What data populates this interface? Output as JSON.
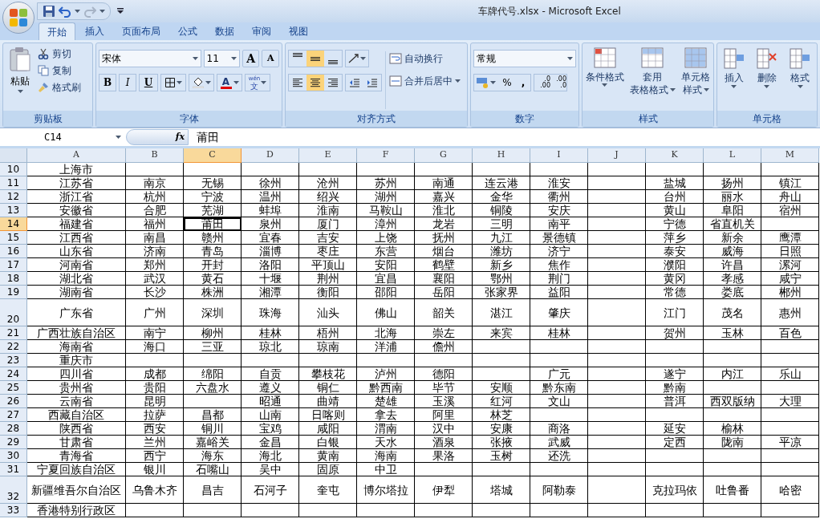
{
  "window": {
    "title": "车牌代号.xlsx - Microsoft Excel"
  },
  "tabs": [
    {
      "label": "开始",
      "selected": true
    },
    {
      "label": "插入",
      "selected": false
    },
    {
      "label": "页面布局",
      "selected": false
    },
    {
      "label": "公式",
      "selected": false
    },
    {
      "label": "数据",
      "selected": false
    },
    {
      "label": "审阅",
      "selected": false
    },
    {
      "label": "视图",
      "selected": false
    }
  ],
  "clipboard": {
    "title": "剪贴板",
    "paste": "粘贴",
    "cut": "剪切",
    "copy": "复制",
    "format_painter": "格式刷"
  },
  "font": {
    "title": "字体",
    "name": "宋体",
    "size": "11",
    "bold": "B",
    "italic": "I",
    "underline": "U",
    "grow": "A",
    "shrink": "A",
    "color_letter": "A",
    "phonetic_top": "wén",
    "phonetic_bottom": "文"
  },
  "alignment": {
    "title": "对齐方式",
    "vertical": [
      {
        "selected": false
      },
      {
        "selected": true
      },
      {
        "selected": false
      }
    ],
    "horizontal": [
      {
        "selected": false
      },
      {
        "selected": true
      },
      {
        "selected": false
      }
    ],
    "wrap": "自动换行",
    "merge": "合并后居中"
  },
  "number": {
    "title": "数字",
    "format": "常规",
    "percent": "%",
    "comma": ",",
    "inc_decimal_top": ".0",
    "inc_decimal_bottom": ".00",
    "dec_decimal_top": ".00",
    "dec_decimal_bottom": ".0"
  },
  "styles": {
    "title": "样式",
    "buttons": [
      {
        "line1": "条件格式"
      },
      {
        "line1": "套用",
        "line2": "表格格式"
      },
      {
        "line1": "单元格",
        "line2": "样式"
      }
    ]
  },
  "cells_group": {
    "title": "单元格",
    "buttons": [
      "插入",
      "删除",
      "格式"
    ]
  },
  "formula_bar": {
    "name_box": "C14",
    "fx": "fx",
    "value": "莆田"
  },
  "grid": {
    "columns": [
      {
        "label": "A",
        "selected": false
      },
      {
        "label": "B",
        "selected": false
      },
      {
        "label": "C",
        "selected": true
      },
      {
        "label": "D",
        "selected": false
      },
      {
        "label": "E",
        "selected": false
      },
      {
        "label": "F",
        "selected": false
      },
      {
        "label": "G",
        "selected": false
      },
      {
        "label": "H",
        "selected": false
      },
      {
        "label": "I",
        "selected": false
      },
      {
        "label": "J",
        "selected": false
      },
      {
        "label": "K",
        "selected": false
      },
      {
        "label": "L",
        "selected": false
      },
      {
        "label": "M",
        "selected": false
      }
    ],
    "rows": [
      {
        "number": "10",
        "kind": "normal",
        "selected": false,
        "cells": [
          "上海市",
          null,
          null,
          null,
          null,
          null,
          null,
          null,
          null,
          null,
          null,
          null,
          null
        ]
      },
      {
        "number": "11",
        "kind": "normal",
        "selected": false,
        "cells": [
          "江苏省",
          "南京",
          "无锡",
          "徐州",
          "沧州",
          "苏州",
          "南通",
          "连云港",
          "淮安",
          null,
          "盐城",
          "扬州",
          "镇江"
        ]
      },
      {
        "number": "12",
        "kind": "normal",
        "selected": false,
        "cells": [
          "浙江省",
          "杭州",
          "宁波",
          "温州",
          "绍兴",
          "湖州",
          "嘉兴",
          "金华",
          "衢州",
          null,
          "台州",
          "丽水",
          "舟山"
        ]
      },
      {
        "number": "13",
        "kind": "normal",
        "selected": false,
        "cells": [
          "安徽省",
          "合肥",
          "芜湖",
          "蚌埠",
          "淮南",
          "马鞍山",
          "淮北",
          "铜陵",
          "安庆",
          null,
          "黄山",
          "阜阳",
          "宿州"
        ]
      },
      {
        "number": "14",
        "kind": "normal",
        "selected": true,
        "cells": [
          "福建省",
          "福州",
          "莆田",
          "泉州",
          "厦门",
          "漳州",
          "龙岩",
          "三明",
          "南平",
          null,
          "宁德",
          "省直机关",
          null
        ]
      },
      {
        "number": "15",
        "kind": "normal",
        "selected": false,
        "cells": [
          "江西省",
          "南昌",
          "赣州",
          "宜春",
          "吉安",
          "上饶",
          "抚州",
          "九江",
          "景德镇",
          null,
          "萍乡",
          "新余",
          "鹰潭"
        ]
      },
      {
        "number": "16",
        "kind": "normal",
        "selected": false,
        "cells": [
          "山东省",
          "济南",
          "青岛",
          "淄博",
          "枣庄",
          "东营",
          "烟台",
          "潍坊",
          "济宁",
          null,
          "泰安",
          "威海",
          "日照"
        ]
      },
      {
        "number": "17",
        "kind": "normal",
        "selected": false,
        "cells": [
          "河南省",
          "郑州",
          "开封",
          "洛阳",
          "平顶山",
          "安阳",
          "鹤壁",
          "新乡",
          "焦作",
          null,
          "濮阳",
          "许昌",
          "漯河"
        ]
      },
      {
        "number": "18",
        "kind": "normal",
        "selected": false,
        "cells": [
          "湖北省",
          "武汉",
          "黄石",
          "十堰",
          "荆州",
          "宜昌",
          "襄阳",
          "鄂州",
          "荆门",
          null,
          "黄冈",
          "孝感",
          "咸宁"
        ]
      },
      {
        "number": "19",
        "kind": "normal",
        "selected": false,
        "cells": [
          "湖南省",
          "长沙",
          "株洲",
          "湘潭",
          "衡阳",
          "邵阳",
          "岳阳",
          "张家界",
          "益阳",
          null,
          "常德",
          "娄底",
          "郴州"
        ]
      },
      {
        "number": "20",
        "kind": "tall",
        "selected": false,
        "cells": [
          "广东省",
          "广州",
          "深圳",
          "珠海",
          "汕头",
          "佛山",
          "韶关",
          "湛江",
          "肇庆",
          null,
          "江门",
          "茂名",
          "惠州"
        ]
      },
      {
        "number": "21",
        "kind": "normal",
        "selected": false,
        "cells": [
          "广西壮族自治区",
          "南宁",
          "柳州",
          "桂林",
          "梧州",
          "北海",
          "崇左",
          "来宾",
          "桂林",
          null,
          "贺州",
          "玉林",
          "百色"
        ]
      },
      {
        "number": "22",
        "kind": "normal",
        "selected": false,
        "cells": [
          "海南省",
          "海口",
          "三亚",
          "琼北",
          "琼南",
          "洋浦",
          "儋州",
          null,
          null,
          null,
          null,
          null,
          null
        ]
      },
      {
        "number": "23",
        "kind": "normal",
        "selected": false,
        "cells": [
          "重庆市",
          null,
          null,
          null,
          null,
          null,
          null,
          null,
          null,
          null,
          null,
          null,
          null
        ]
      },
      {
        "number": "24",
        "kind": "normal",
        "selected": false,
        "cells": [
          "四川省",
          "成都",
          "绵阳",
          "自贡",
          "攀枝花",
          "泸州",
          "德阳",
          null,
          "广元",
          null,
          "遂宁",
          "内江",
          "乐山"
        ]
      },
      {
        "number": "25",
        "kind": "normal",
        "selected": false,
        "cells": [
          "贵州省",
          "贵阳",
          "六盘水",
          "遵义",
          "铜仁",
          "黔西南",
          "毕节",
          "安顺",
          "黔东南",
          null,
          "黔南",
          null,
          null
        ]
      },
      {
        "number": "26",
        "kind": "normal",
        "selected": false,
        "cells": [
          "云南省",
          "昆明",
          null,
          "昭通",
          "曲靖",
          "楚雄",
          "玉溪",
          "红河",
          "文山",
          null,
          "普洱",
          "西双版纳",
          "大理"
        ]
      },
      {
        "number": "27",
        "kind": "normal",
        "selected": false,
        "cells": [
          "西藏自治区",
          "拉萨",
          "昌都",
          "山南",
          "日喀则",
          "拿去",
          "阿里",
          "林芝",
          null,
          null,
          null,
          null,
          null
        ]
      },
      {
        "number": "28",
        "kind": "normal",
        "selected": false,
        "cells": [
          "陕西省",
          "西安",
          "铜川",
          "宝鸡",
          "咸阳",
          "渭南",
          "汉中",
          "安康",
          "商洛",
          null,
          "延安",
          "榆林",
          null
        ]
      },
      {
        "number": "29",
        "kind": "normal",
        "selected": false,
        "cells": [
          "甘肃省",
          "兰州",
          "嘉峪关",
          "金昌",
          "白银",
          "天水",
          "酒泉",
          "张掖",
          "武威",
          null,
          "定西",
          "陇南",
          "平凉"
        ]
      },
      {
        "number": "30",
        "kind": "normal",
        "selected": false,
        "cells": [
          "青海省",
          "西宁",
          "海东",
          "海北",
          "黄南",
          "海南",
          "果洛",
          "玉树",
          "还洗",
          null,
          null,
          null,
          null
        ]
      },
      {
        "number": "31",
        "kind": "normal",
        "selected": false,
        "cells": [
          "宁夏回族自治区",
          "银川",
          "石嘴山",
          "吴中",
          "固原",
          "中卫",
          null,
          null,
          null,
          null,
          null,
          null,
          null
        ]
      },
      {
        "number": "32",
        "kind": "tall",
        "selected": false,
        "cells": [
          "新疆维吾尔自治区",
          "乌鲁木齐",
          "昌吉",
          "石河子",
          "奎屯",
          "博尔塔拉",
          "伊犁",
          "塔城",
          "阿勒泰",
          null,
          "克拉玛依",
          "吐鲁番",
          "哈密"
        ]
      },
      {
        "number": "33",
        "kind": "normal",
        "selected": false,
        "cells": [
          "香港特别行政区",
          null,
          null,
          null,
          null,
          null,
          null,
          null,
          null,
          null,
          null,
          null,
          null
        ]
      }
    ]
  }
}
